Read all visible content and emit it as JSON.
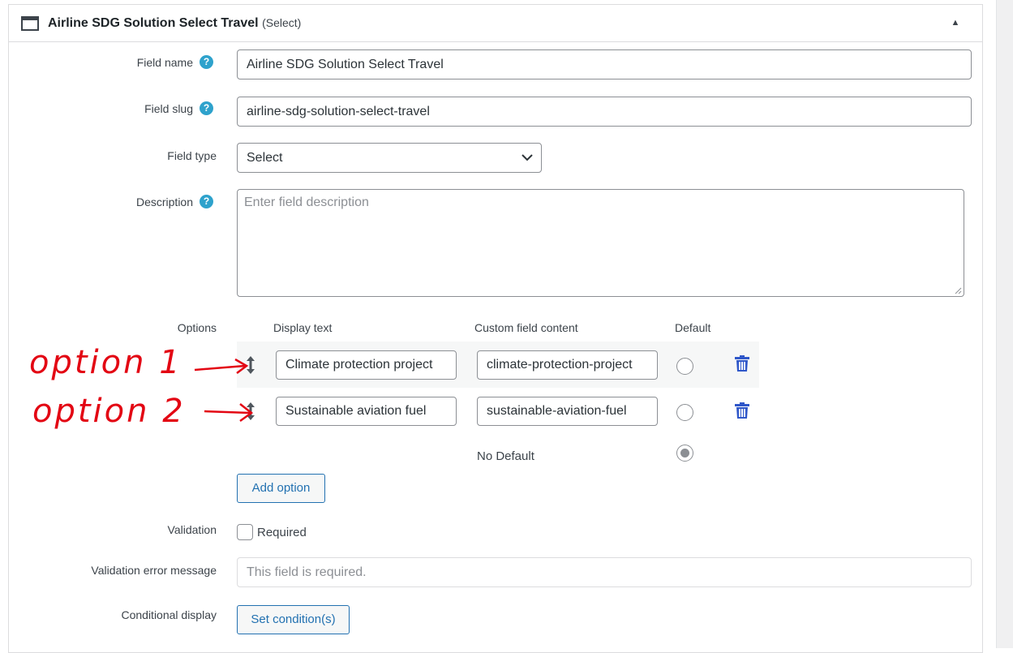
{
  "header": {
    "title": "Airline SDG Solution Select Travel",
    "type_suffix": "(Select)",
    "icon": "window-icon",
    "toggle": "▲"
  },
  "fields": {
    "field_name": {
      "label": "Field name",
      "value": "Airline SDG Solution Select Travel"
    },
    "field_slug": {
      "label": "Field slug",
      "value": "airline-sdg-solution-select-travel"
    },
    "field_type": {
      "label": "Field type",
      "value": "Select"
    },
    "description": {
      "label": "Description",
      "placeholder": "Enter field description"
    }
  },
  "help_glyph": "?",
  "options": {
    "label": "Options",
    "columns": {
      "display_text": "Display text",
      "custom_content": "Custom field content",
      "default": "Default"
    },
    "rows": [
      {
        "display_text": "Climate protection project",
        "custom_content": "climate-protection-project",
        "is_default": false
      },
      {
        "display_text": "Sustainable aviation fuel",
        "custom_content": "sustainable-aviation-fuel",
        "is_default": false
      }
    ],
    "no_default_label": "No Default",
    "no_default_selected": true,
    "add_button": "Add option"
  },
  "validation": {
    "label": "Validation",
    "required_label": "Required",
    "required_checked": false
  },
  "validation_error": {
    "label": "Validation error message",
    "placeholder": "This field is required."
  },
  "conditional": {
    "label": "Conditional display",
    "button": "Set condition(s)"
  },
  "annotations": [
    {
      "text": "option 1"
    },
    {
      "text": "option 2"
    }
  ],
  "colors": {
    "accent": "#2271b1",
    "help": "#2ea2cc",
    "annotation": "#e30613",
    "trash": "#2f57c9"
  }
}
